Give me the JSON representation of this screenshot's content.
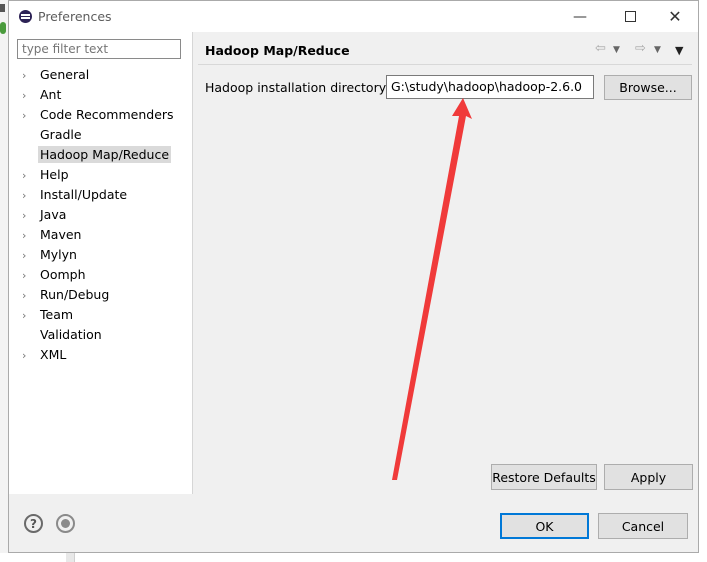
{
  "window": {
    "title": "Preferences",
    "minimize_glyph": "—",
    "close_glyph": "✕"
  },
  "filter": {
    "placeholder": "type filter text"
  },
  "tree": {
    "items": [
      {
        "label": "General",
        "expandable": true
      },
      {
        "label": "Ant",
        "expandable": true
      },
      {
        "label": "Code Recommenders",
        "expandable": true
      },
      {
        "label": "Gradle",
        "expandable": false
      },
      {
        "label": "Hadoop Map/Reduce",
        "expandable": false,
        "selected": true
      },
      {
        "label": "Help",
        "expandable": true
      },
      {
        "label": "Install/Update",
        "expandable": true
      },
      {
        "label": "Java",
        "expandable": true
      },
      {
        "label": "Maven",
        "expandable": true
      },
      {
        "label": "Mylyn",
        "expandable": true
      },
      {
        "label": "Oomph",
        "expandable": true
      },
      {
        "label": "Run/Debug",
        "expandable": true
      },
      {
        "label": "Team",
        "expandable": true
      },
      {
        "label": "Validation",
        "expandable": false
      },
      {
        "label": "XML",
        "expandable": true
      }
    ]
  },
  "page": {
    "title": "Hadoop Map/Reduce",
    "dir_label": "Hadoop installation directory:",
    "dir_value": "G:\\study\\hadoop\\hadoop-2.6.0",
    "browse_label": "Browse...",
    "restore_label": "Restore Defaults",
    "apply_label": "Apply"
  },
  "nav": {
    "back_glyph": "⇦",
    "forward_glyph": "⇨",
    "dropdown_glyph": "▼",
    "menu_glyph": "▼"
  },
  "footer": {
    "help_glyph": "?",
    "ok_label": "OK",
    "cancel_label": "Cancel"
  },
  "colors": {
    "annotation_arrow": "#f03a3a",
    "default_button_border": "#0078d7",
    "selection": "#dadada"
  }
}
